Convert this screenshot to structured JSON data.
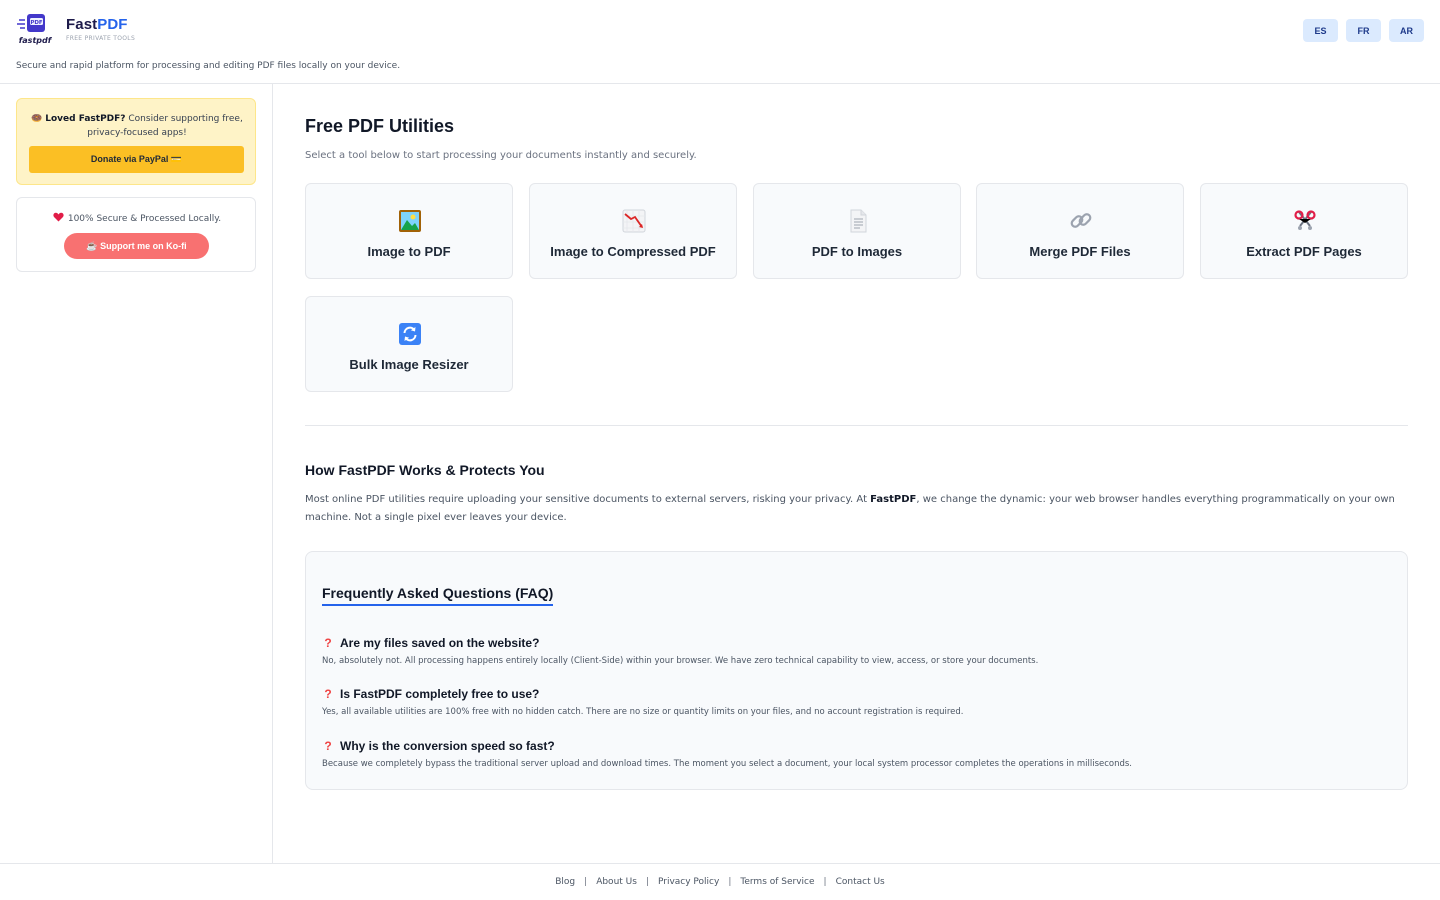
{
  "header": {
    "brand_fast": "Fast",
    "brand_pdf": "PDF",
    "brand_sub": "FREE PRIVATE TOOLS",
    "logo_badge": "PDF",
    "logo_word": "fastpdf",
    "tagline": "Secure and rapid platform for processing and editing PDF files locally on your device.",
    "languages": [
      "ES",
      "FR",
      "AR"
    ]
  },
  "sidebar": {
    "donate_emoji": "🍩",
    "donate_bold": "Loved FastPDF?",
    "donate_text": " Consider supporting free, privacy-focused apps!",
    "paypal_label": "Donate via PayPal 💳",
    "secure_text": "100% Secure & Processed Locally.",
    "kofi_label": "☕ Support me on Ko-fi"
  },
  "main": {
    "title": "Free PDF Utilities",
    "subtitle": "Select a tool below to start processing your documents instantly and securely.",
    "tools": [
      {
        "label": "Image to PDF",
        "icon": "picture-icon"
      },
      {
        "label": "Image to Compressed PDF",
        "icon": "chart-down-icon"
      },
      {
        "label": "PDF to Images",
        "icon": "document-icon"
      },
      {
        "label": "Merge PDF Files",
        "icon": "link-icon"
      },
      {
        "label": "Extract PDF Pages",
        "icon": "scissors-icon"
      },
      {
        "label": "Bulk Image Resizer",
        "icon": "refresh-icon"
      }
    ]
  },
  "how": {
    "title": "How FastPDF Works & Protects You",
    "body_1": "Most online PDF utilities require uploading your sensitive documents to external servers, risking your privacy. At ",
    "body_bold": "FastPDF",
    "body_2": ", we change the dynamic: your web browser handles everything programmatically on your own machine. Not a single pixel ever leaves your device."
  },
  "faq": {
    "title": "Frequently Asked Questions (FAQ)",
    "items": [
      {
        "q": "Are my files saved on the website?",
        "a": "No, absolutely not. All processing happens entirely locally (Client-Side) within your browser. We have zero technical capability to view, access, or store your documents."
      },
      {
        "q": "Is FastPDF completely free to use?",
        "a": "Yes, all available utilities are 100% free with no hidden catch. There are no size or quantity limits on your files, and no account registration is required."
      },
      {
        "q": "Why is the conversion speed so fast?",
        "a": "Because we completely bypass the traditional server upload and download times. The moment you select a document, your local system processor completes the operations in milliseconds."
      }
    ]
  },
  "footer": {
    "links": [
      "Blog",
      "About Us",
      "Privacy Policy",
      "Terms of Service",
      "Contact Us"
    ],
    "separator": "|"
  }
}
